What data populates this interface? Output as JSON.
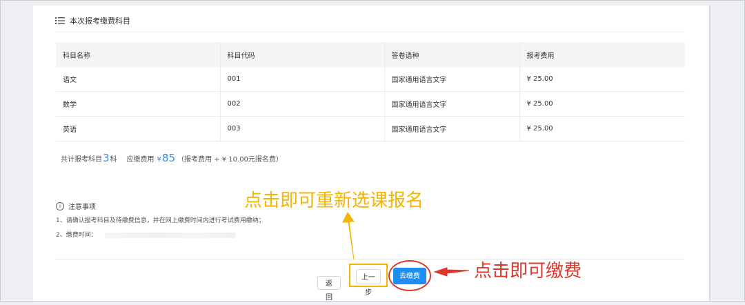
{
  "section": {
    "title": "本次报考缴费科目",
    "icon": "list-icon"
  },
  "table": {
    "headers": [
      "科目名称",
      "科目代码",
      "答卷语种",
      "报考费用"
    ],
    "rows": [
      [
        "语文",
        "001",
        "国家通用语言文字",
        "¥ 25.00"
      ],
      [
        "数学",
        "002",
        "国家通用语言文字",
        "¥ 25.00"
      ],
      [
        "英语",
        "003",
        "国家通用语言文字",
        "¥ 25.00"
      ]
    ]
  },
  "summary": {
    "count_prefix": "共计报考科目",
    "count_value": "3",
    "count_suffix": "科",
    "fee_label": "应缴费用",
    "fee_currency": "¥",
    "fee_value": "85",
    "fee_note": "（报考费用 + ¥ 10.00元报名费）"
  },
  "notice": {
    "title": "注意事项",
    "lines": [
      "1、请确认报考科目及待缴费信息，并在网上缴费时间内进行考试费用缴纳；",
      "2、缴费时间："
    ]
  },
  "buttons": {
    "back": "返 回",
    "prev": "上一步",
    "pay": "去缴费"
  },
  "annotations": {
    "prev_hint": "点击即可重新选课报名",
    "pay_hint": "点击即可缴费",
    "yellow": "#f4b400",
    "red": "#e0352b"
  },
  "colors": {
    "primary": "#1f8ef2",
    "accent_text": "#2e8fe8"
  }
}
